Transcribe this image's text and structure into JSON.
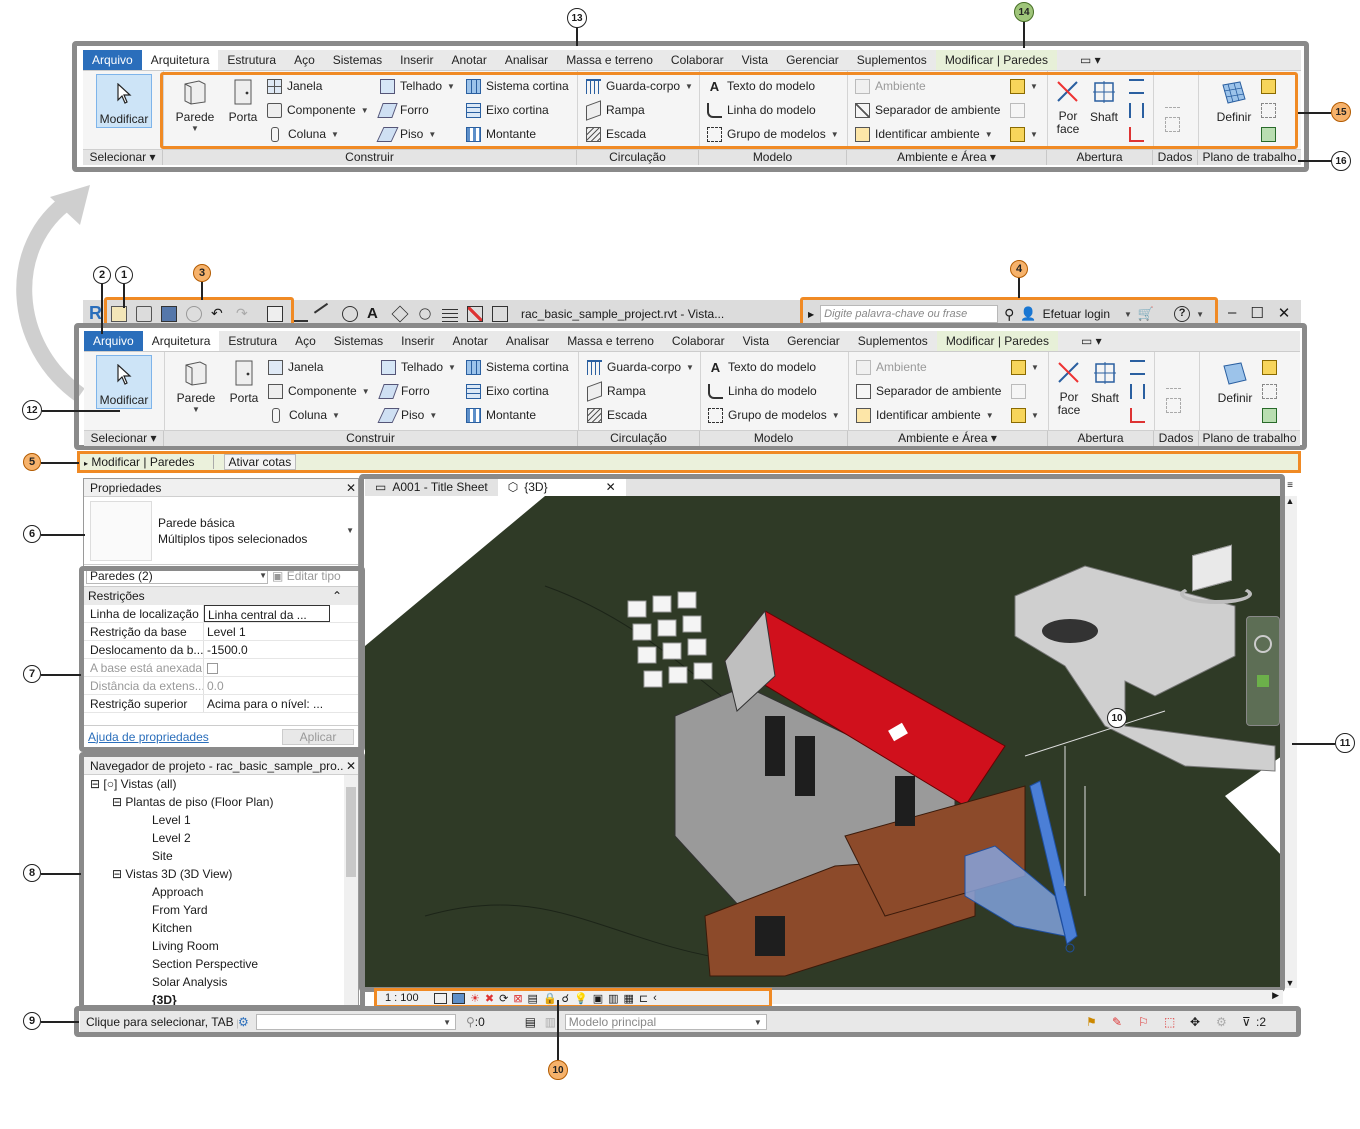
{
  "ribbon": {
    "tabs": [
      "Arquivo",
      "Arquitetura",
      "Estrutura",
      "Aço",
      "Sistemas",
      "Inserir",
      "Anotar",
      "Analisar",
      "Massa e terreno",
      "Colaborar",
      "Vista",
      "Gerenciar",
      "Suplementos",
      "Modificar | Paredes"
    ],
    "select_label": "Modificar",
    "panels": [
      "Selecionar",
      "Construir",
      "Circulação",
      "Modelo",
      "Ambiente e Área",
      "Abertura",
      "Dados",
      "Plano de trabalho"
    ],
    "build": {
      "wall": "Parede",
      "door": "Porta",
      "window": "Janela",
      "component": "Componente",
      "column": "Coluna",
      "roof": "Telhado",
      "ceiling": "Forro",
      "floor": "Piso",
      "curtain_system": "Sistema cortina",
      "curtain_grid": "Eixo cortina",
      "mullion": "Montante"
    },
    "circulation": {
      "railing": "Guarda-corpo",
      "ramp": "Rampa",
      "stair": "Escada"
    },
    "model": {
      "model_text": "Texto do modelo",
      "model_line": "Linha do modelo",
      "model_group": "Grupo de modelos"
    },
    "room": {
      "room": "Ambiente",
      "room_separator": "Separador de ambiente",
      "tag_room": "Identificar ambiente"
    },
    "opening": {
      "by_face": "Por face",
      "shaft": "Shaft"
    },
    "workplane": {
      "set": "Definir"
    }
  },
  "qat": {
    "title": "rac_basic_sample_project.rvt - Vista...",
    "search_placeholder": "Digite palavra-chave ou frase",
    "login": "Efetuar login"
  },
  "options_bar": {
    "context": "Modificar | Paredes",
    "activate": "Ativar cotas"
  },
  "properties": {
    "title": "Propriedades",
    "type_line1": "Parede básica",
    "type_line2": "Múltiplos tipos selecionados",
    "filter": "Paredes (2)",
    "edit_type": "Editar tipo",
    "section": "Restrições",
    "rows": [
      {
        "k": "Linha de localização",
        "v": "Linha central da ..."
      },
      {
        "k": "Restrição da base",
        "v": "Level 1"
      },
      {
        "k": "Deslocamento da b...",
        "v": "-1500.0"
      },
      {
        "k": "A base está anexada",
        "v": ""
      },
      {
        "k": "Distância da extens...",
        "v": "0.0"
      },
      {
        "k": "Restrição superior",
        "v": "Acima para o nível: ..."
      }
    ],
    "help": "Ajuda de propriedades",
    "apply": "Aplicar"
  },
  "browser": {
    "title": "Navegador de projeto - rac_basic_sample_pro...",
    "items": [
      {
        "t": "Vistas (all)",
        "lvl": 0
      },
      {
        "t": "Plantas de piso (Floor Plan)",
        "lvl": 1
      },
      {
        "t": "Level 1",
        "lvl": 2
      },
      {
        "t": "Level 2",
        "lvl": 2
      },
      {
        "t": "Site",
        "lvl": 2
      },
      {
        "t": "Vistas 3D (3D View)",
        "lvl": 1
      },
      {
        "t": "Approach",
        "lvl": 2
      },
      {
        "t": "From Yard",
        "lvl": 2
      },
      {
        "t": "Kitchen",
        "lvl": 2
      },
      {
        "t": "Living Room",
        "lvl": 2
      },
      {
        "t": "Section Perspective",
        "lvl": 2
      },
      {
        "t": "Solar Analysis",
        "lvl": 2
      },
      {
        "t": "{3D}",
        "lvl": 2
      }
    ]
  },
  "viewport": {
    "tab1": "A001 - Title Sheet",
    "tab2": "{3D}",
    "scale": "1 : 100"
  },
  "status": {
    "hint": "Clique para selecionar, TAB p",
    "zero": ":0",
    "model": "Modelo principal",
    "filter_count": ":2"
  },
  "callouts": {
    "c1": "1",
    "c2": "2",
    "c3": "3",
    "c4": "4",
    "c5": "5",
    "c6": "6",
    "c7": "7",
    "c8": "8",
    "c9": "9",
    "c10": "10",
    "c11": "11",
    "c12": "12",
    "c13": "13",
    "c14": "14",
    "c15": "15",
    "c16": "16"
  },
  "colors": {
    "file_tab": "#2a6ebb",
    "frame": "#8a8a8a",
    "highlight": "#f08a24",
    "roof": "#d0101c",
    "ground": "#2f3a26",
    "context_tab": "#e7f0d8"
  }
}
